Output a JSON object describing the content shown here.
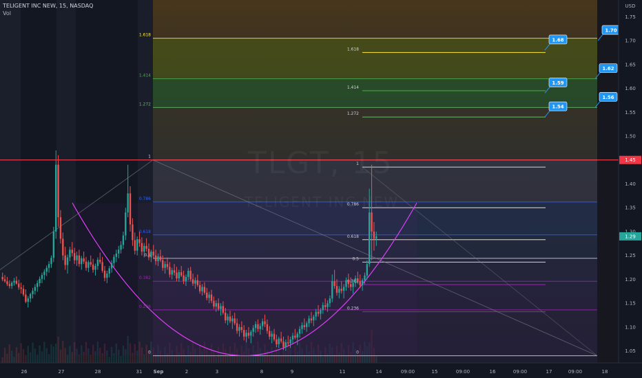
{
  "header": {
    "symbol_line": "TELIGENT INC NEW, 15, NASDAQ",
    "vol_label": "Vol",
    "watermark_ticker": "TLGT, 15",
    "watermark_name": "TELIGENT INC NEW"
  },
  "currency": "USD",
  "colors": {
    "background": "#131722",
    "up": "#26a69a",
    "down": "#ef5350",
    "red_line": "#f23645",
    "white_line": "#d1d4dc",
    "blue_level": "#2962ff",
    "purple_level": "#9c27b0",
    "green_level": "#4caf50",
    "yellow_level": "#ffeb3b",
    "cup_arc": "#e040fb",
    "label_blue": "#2196f3"
  },
  "chart_data": {
    "type": "candlestick",
    "y_axis": {
      "range": [
        1.025,
        1.785
      ],
      "ticks": [
        "1.05",
        "1.10",
        "1.15",
        "1.20",
        "1.25",
        "1.30",
        "1.35",
        "1.40",
        "1.45",
        "1.50",
        "1.55",
        "1.60",
        "1.65",
        "1.70",
        "1.75"
      ]
    },
    "x_axis": {
      "ticks": [
        "26",
        "27",
        "28",
        "31",
        "Sep",
        "2",
        "3",
        "8",
        "9",
        "11",
        "14",
        "09:00",
        "15",
        "09:00",
        "16",
        "09:00",
        "17",
        "09:00",
        "18"
      ]
    },
    "price_tags": [
      {
        "value": 1.45,
        "label": "1.45",
        "color": "#f23645"
      },
      {
        "value": 1.29,
        "label": "1.29",
        "color": "#26a69a"
      }
    ],
    "candles": [
      [
        1.205,
        1.214,
        1.196,
        1.2
      ],
      [
        1.2,
        1.209,
        1.193,
        1.196
      ],
      [
        1.196,
        1.205,
        1.186,
        1.19
      ],
      [
        1.19,
        1.198,
        1.181,
        1.186
      ],
      [
        1.186,
        1.196,
        1.18,
        1.193
      ],
      [
        1.193,
        1.203,
        1.187,
        1.197
      ],
      [
        1.197,
        1.206,
        1.189,
        1.191
      ],
      [
        1.191,
        1.199,
        1.178,
        1.183
      ],
      [
        1.183,
        1.193,
        1.17,
        1.18
      ],
      [
        1.18,
        1.188,
        1.164,
        1.168
      ],
      [
        1.168,
        1.179,
        1.15,
        1.153
      ],
      [
        1.153,
        1.165,
        1.141,
        1.16
      ],
      [
        1.16,
        1.172,
        1.152,
        1.169
      ],
      [
        1.169,
        1.182,
        1.16,
        1.176
      ],
      [
        1.176,
        1.19,
        1.168,
        1.184
      ],
      [
        1.184,
        1.198,
        1.174,
        1.192
      ],
      [
        1.192,
        1.206,
        1.185,
        1.201
      ],
      [
        1.201,
        1.214,
        1.192,
        1.209
      ],
      [
        1.209,
        1.221,
        1.199,
        1.216
      ],
      [
        1.216,
        1.229,
        1.207,
        1.224
      ],
      [
        1.224,
        1.238,
        1.214,
        1.232
      ],
      [
        1.232,
        1.25,
        1.224,
        1.245
      ],
      [
        1.245,
        1.31,
        1.236,
        1.3
      ],
      [
        1.3,
        1.47,
        1.285,
        1.44
      ],
      [
        1.44,
        1.46,
        1.31,
        1.33
      ],
      [
        1.33,
        1.345,
        1.275,
        1.285
      ],
      [
        1.285,
        1.298,
        1.24,
        1.25
      ],
      [
        1.25,
        1.268,
        1.22,
        1.23
      ],
      [
        1.23,
        1.252,
        1.212,
        1.246
      ],
      [
        1.246,
        1.268,
        1.238,
        1.262
      ],
      [
        1.262,
        1.278,
        1.248,
        1.255
      ],
      [
        1.255,
        1.266,
        1.232,
        1.24
      ],
      [
        1.24,
        1.258,
        1.228,
        1.25
      ],
      [
        1.25,
        1.262,
        1.226,
        1.232
      ],
      [
        1.232,
        1.249,
        1.22,
        1.244
      ],
      [
        1.244,
        1.258,
        1.232,
        1.237
      ],
      [
        1.237,
        1.247,
        1.218,
        1.224
      ],
      [
        1.224,
        1.24,
        1.215,
        1.236
      ],
      [
        1.236,
        1.25,
        1.226,
        1.231
      ],
      [
        1.231,
        1.243,
        1.214,
        1.22
      ],
      [
        1.22,
        1.233,
        1.208,
        1.228
      ],
      [
        1.228,
        1.246,
        1.22,
        1.241
      ],
      [
        1.241,
        1.256,
        1.232,
        1.236
      ],
      [
        1.236,
        1.247,
        1.214,
        1.218
      ],
      [
        1.218,
        1.228,
        1.196,
        1.203
      ],
      [
        1.203,
        1.218,
        1.192,
        1.212
      ],
      [
        1.212,
        1.228,
        1.204,
        1.223
      ],
      [
        1.223,
        1.24,
        1.214,
        1.234
      ],
      [
        1.234,
        1.252,
        1.226,
        1.247
      ],
      [
        1.247,
        1.262,
        1.236,
        1.254
      ],
      [
        1.254,
        1.27,
        1.244,
        1.262
      ],
      [
        1.262,
        1.28,
        1.254,
        1.272
      ],
      [
        1.272,
        1.3,
        1.264,
        1.292
      ],
      [
        1.292,
        1.35,
        1.282,
        1.34
      ],
      [
        1.34,
        1.44,
        1.33,
        1.38
      ],
      [
        1.38,
        1.395,
        1.3,
        1.315
      ],
      [
        1.315,
        1.328,
        1.27,
        1.282
      ],
      [
        1.282,
        1.298,
        1.252,
        1.26
      ],
      [
        1.26,
        1.29,
        1.25,
        1.284
      ],
      [
        1.284,
        1.3,
        1.268,
        1.276
      ],
      [
        1.276,
        1.288,
        1.25,
        1.258
      ],
      [
        1.258,
        1.276,
        1.246,
        1.27
      ],
      [
        1.27,
        1.286,
        1.258,
        1.264
      ],
      [
        1.264,
        1.275,
        1.24,
        1.246
      ],
      [
        1.246,
        1.262,
        1.236,
        1.258
      ],
      [
        1.258,
        1.272,
        1.244,
        1.25
      ],
      [
        1.25,
        1.262,
        1.23,
        1.238
      ],
      [
        1.238,
        1.254,
        1.228,
        1.248
      ],
      [
        1.248,
        1.262,
        1.236,
        1.24
      ],
      [
        1.24,
        1.25,
        1.218,
        1.224
      ],
      [
        1.224,
        1.238,
        1.212,
        1.232
      ],
      [
        1.232,
        1.246,
        1.22,
        1.226
      ],
      [
        1.226,
        1.236,
        1.204,
        1.21
      ],
      [
        1.21,
        1.224,
        1.2,
        1.219
      ],
      [
        1.219,
        1.232,
        1.208,
        1.214
      ],
      [
        1.214,
        1.226,
        1.196,
        1.202
      ],
      [
        1.202,
        1.22,
        1.195,
        1.215
      ],
      [
        1.215,
        1.228,
        1.205,
        1.208
      ],
      [
        1.208,
        1.218,
        1.19,
        1.196
      ],
      [
        1.196,
        1.21,
        1.186,
        1.205
      ],
      [
        1.205,
        1.224,
        1.198,
        1.218
      ],
      [
        1.218,
        1.226,
        1.196,
        1.2
      ],
      [
        1.2,
        1.212,
        1.186,
        1.191
      ],
      [
        1.191,
        1.204,
        1.18,
        1.198
      ],
      [
        1.198,
        1.21,
        1.184,
        1.188
      ],
      [
        1.188,
        1.196,
        1.17,
        1.175
      ],
      [
        1.175,
        1.19,
        1.166,
        1.184
      ],
      [
        1.184,
        1.194,
        1.168,
        1.172
      ],
      [
        1.172,
        1.182,
        1.156,
        1.161
      ],
      [
        1.161,
        1.174,
        1.15,
        1.168
      ],
      [
        1.168,
        1.178,
        1.15,
        1.155
      ],
      [
        1.155,
        1.164,
        1.138,
        1.143
      ],
      [
        1.143,
        1.156,
        1.132,
        1.15
      ],
      [
        1.15,
        1.16,
        1.134,
        1.138
      ],
      [
        1.138,
        1.15,
        1.124,
        1.144
      ],
      [
        1.144,
        1.154,
        1.126,
        1.13
      ],
      [
        1.13,
        1.14,
        1.108,
        1.114
      ],
      [
        1.114,
        1.128,
        1.104,
        1.122
      ],
      [
        1.122,
        1.134,
        1.108,
        1.112
      ],
      [
        1.112,
        1.124,
        1.096,
        1.118
      ],
      [
        1.118,
        1.13,
        1.104,
        1.108
      ],
      [
        1.108,
        1.118,
        1.086,
        1.092
      ],
      [
        1.092,
        1.106,
        1.08,
        1.1
      ],
      [
        1.1,
        1.112,
        1.088,
        1.094
      ],
      [
        1.094,
        1.104,
        1.072,
        1.08
      ],
      [
        1.08,
        1.094,
        1.068,
        1.088
      ],
      [
        1.088,
        1.1,
        1.076,
        1.082
      ],
      [
        1.082,
        1.094,
        1.066,
        1.09
      ],
      [
        1.09,
        1.104,
        1.08,
        1.098
      ],
      [
        1.098,
        1.112,
        1.088,
        1.106
      ],
      [
        1.106,
        1.116,
        1.09,
        1.096
      ],
      [
        1.096,
        1.108,
        1.084,
        1.102
      ],
      [
        1.102,
        1.118,
        1.094,
        1.112
      ],
      [
        1.112,
        1.126,
        1.1,
        1.106
      ],
      [
        1.106,
        1.116,
        1.086,
        1.092
      ],
      [
        1.092,
        1.102,
        1.074,
        1.08
      ],
      [
        1.08,
        1.092,
        1.066,
        1.086
      ],
      [
        1.086,
        1.096,
        1.07,
        1.074
      ],
      [
        1.074,
        1.084,
        1.058,
        1.064
      ],
      [
        1.064,
        1.08,
        1.056,
        1.076
      ],
      [
        1.076,
        1.09,
        1.066,
        1.07
      ],
      [
        1.07,
        1.08,
        1.052,
        1.058
      ],
      [
        1.058,
        1.074,
        1.05,
        1.068
      ],
      [
        1.068,
        1.082,
        1.06,
        1.066
      ],
      [
        1.066,
        1.08,
        1.056,
        1.074
      ],
      [
        1.074,
        1.088,
        1.066,
        1.082
      ],
      [
        1.082,
        1.096,
        1.074,
        1.078
      ],
      [
        1.078,
        1.09,
        1.062,
        1.086
      ],
      [
        1.086,
        1.102,
        1.078,
        1.096
      ],
      [
        1.096,
        1.11,
        1.086,
        1.104
      ],
      [
        1.104,
        1.118,
        1.094,
        1.1
      ],
      [
        1.1,
        1.112,
        1.09,
        1.108
      ],
      [
        1.108,
        1.124,
        1.1,
        1.118
      ],
      [
        1.118,
        1.132,
        1.108,
        1.114
      ],
      [
        1.114,
        1.126,
        1.102,
        1.122
      ],
      [
        1.122,
        1.138,
        1.114,
        1.132
      ],
      [
        1.132,
        1.146,
        1.122,
        1.128
      ],
      [
        1.128,
        1.14,
        1.116,
        1.136
      ],
      [
        1.136,
        1.152,
        1.128,
        1.146
      ],
      [
        1.146,
        1.16,
        1.136,
        1.142
      ],
      [
        1.142,
        1.156,
        1.132,
        1.15
      ],
      [
        1.15,
        1.166,
        1.142,
        1.16
      ],
      [
        1.16,
        1.21,
        1.152,
        1.196
      ],
      [
        1.196,
        1.22,
        1.18,
        1.186
      ],
      [
        1.186,
        1.2,
        1.166,
        1.172
      ],
      [
        1.172,
        1.186,
        1.16,
        1.18
      ],
      [
        1.18,
        1.196,
        1.17,
        1.176
      ],
      [
        1.176,
        1.19,
        1.16,
        1.184
      ],
      [
        1.184,
        1.204,
        1.176,
        1.198
      ],
      [
        1.198,
        1.212,
        1.182,
        1.19
      ],
      [
        1.19,
        1.204,
        1.176,
        1.184
      ],
      [
        1.184,
        1.198,
        1.17,
        1.192
      ],
      [
        1.192,
        1.208,
        1.184,
        1.202
      ],
      [
        1.202,
        1.216,
        1.19,
        1.196
      ],
      [
        1.196,
        1.21,
        1.182,
        1.188
      ],
      [
        1.188,
        1.202,
        1.176,
        1.198
      ],
      [
        1.198,
        1.214,
        1.19,
        1.208
      ],
      [
        1.208,
        1.24,
        1.2,
        1.232
      ],
      [
        1.232,
        1.39,
        1.226,
        1.34
      ],
      [
        1.34,
        1.44,
        1.24,
        1.3
      ],
      [
        1.3,
        1.32,
        1.26,
        1.285
      ],
      [
        1.285,
        1.3,
        1.27,
        1.29
      ]
    ],
    "fib_retracement_left": {
      "levels": [
        {
          "label": "1.618",
          "value": 1.705
        },
        {
          "label": "1.414",
          "value": 1.62
        },
        {
          "label": "1.272",
          "value": 1.56
        },
        {
          "label": "1",
          "value": 1.45
        },
        {
          "label": "0.786",
          "value": 1.362
        },
        {
          "label": "0.618",
          "value": 1.293
        },
        {
          "label": "0.5",
          "value": 1.244
        },
        {
          "label": "0.382",
          "value": 1.196
        },
        {
          "label": "0.236",
          "value": 1.136
        },
        {
          "label": "0",
          "value": 1.04
        }
      ]
    },
    "fib_retracement_right": {
      "levels": [
        {
          "label": "1.618",
          "value": 1.675
        },
        {
          "label": "1.414",
          "value": 1.595
        },
        {
          "label": "1.272",
          "value": 1.54
        },
        {
          "label": "1",
          "value": 1.435
        },
        {
          "label": "0.786",
          "value": 1.35
        },
        {
          "label": "0.618",
          "value": 1.283
        },
        {
          "label": "0.5",
          "value": 1.236
        },
        {
          "label": "0.382",
          "value": 1.189
        },
        {
          "label": "0.236",
          "value": 1.132
        },
        {
          "label": "0",
          "value": 1.04
        }
      ]
    },
    "callouts": [
      {
        "label": "1.70",
        "value": 1.7
      },
      {
        "label": "1.68",
        "value": 1.68
      },
      {
        "label": "1.62",
        "value": 1.62
      },
      {
        "label": "1.59",
        "value": 1.59
      },
      {
        "label": "1.56",
        "value": 1.56
      },
      {
        "label": "1.54",
        "value": 1.54
      }
    ],
    "horizontal_line": {
      "value": 1.45,
      "label": "1.45"
    },
    "cup_pattern": {
      "bottom_value": 1.04,
      "rim_value": 1.36
    }
  }
}
